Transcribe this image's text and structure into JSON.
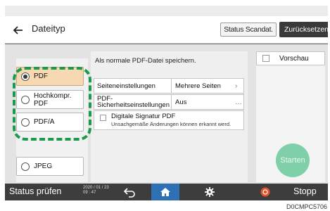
{
  "header": {
    "title": "Dateityp",
    "status_scan_label": "Status Scandat.",
    "reset_label": "Zurücksetzen"
  },
  "file_types": [
    {
      "label": "PDF",
      "selected": true
    },
    {
      "label": "Hochkompr. PDF",
      "selected": false
    },
    {
      "label": "PDF/A",
      "selected": false
    },
    {
      "label": "JPEG",
      "selected": false
    }
  ],
  "settings": {
    "info": "Als normale PDF-Datei speichern.",
    "page_settings_label": "Seiteneinstellungen",
    "page_settings_value": "Mehrere Seiten",
    "security_label_line1": "PDF-",
    "security_label_line2": "Sicherheitseinstellungen",
    "security_value": "Aus",
    "signature_label": "Digitale Signatur PDF",
    "signature_desc": "Unsachgemäße Änderungen können erkannt werd."
  },
  "preview": {
    "label": "Vorschau"
  },
  "start_label": "Starten",
  "status_bar": {
    "status_check": "Status prüfen",
    "date": "2020 / 01 / 23",
    "time": "09 : 47",
    "stop_label": "Stopp"
  },
  "code": "D0CMPC5706",
  "colors": {
    "highlight": "#1a9a4a",
    "selected_item": "#f6d9b2",
    "start_button": "#7fcfa8",
    "home_button": "#2f6fb3",
    "stop_icon": "#e5532d"
  }
}
